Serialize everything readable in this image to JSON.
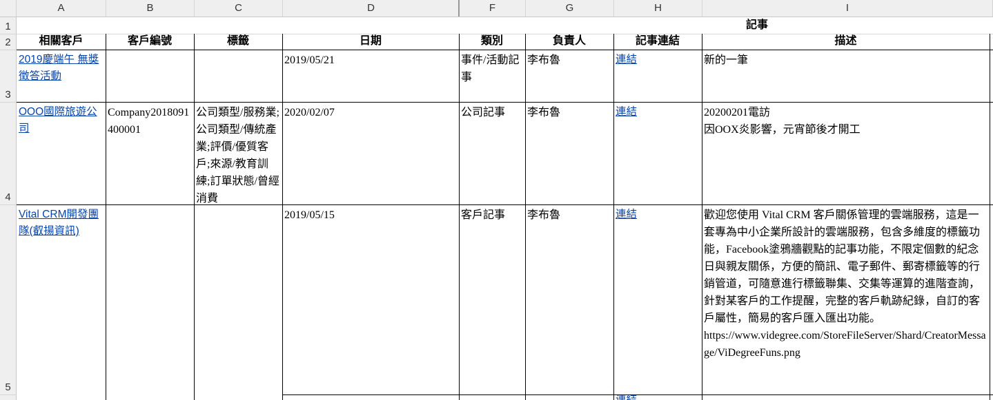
{
  "columns": [
    "A",
    "B",
    "C",
    "D",
    "F",
    "G",
    "H",
    "I"
  ],
  "rows": [
    "1",
    "2",
    "3",
    "4",
    "5"
  ],
  "group_header": "記事",
  "headers": [
    "相關客戶",
    "客戶編號",
    "標籤",
    "日期",
    "類別",
    "負責人",
    "記事連結",
    "描述"
  ],
  "records": [
    {
      "customer": "2019慶端午 無獎徵答活動",
      "customer_id": "",
      "tags": "",
      "date": "2019/05/21",
      "category": "事件/活動記事",
      "owner": "李布魯",
      "link": "連結",
      "description": "新的一筆"
    },
    {
      "customer": "OOO國際旅遊公司",
      "customer_id": "Company2018091400001",
      "tags": "公司類型/服務業;公司類型/傳統產業;評價/優質客戶;來源/教育訓練;訂單狀態/曾經消費",
      "date": "2020/02/07",
      "category": "公司記事",
      "owner": "李布魯",
      "link": "連結",
      "description": "20200201電訪\n因OOX炎影響，元宵節後才開工"
    },
    {
      "customer": "Vital CRM開發團隊(叡揚資訊)",
      "customer_id": "",
      "tags": "",
      "date": "2019/05/15",
      "category": "客戶記事",
      "owner": "李布魯",
      "link": "連結",
      "description": "歡迎您使用 Vital CRM 客戶關係管理的雲端服務，這是一套專為中小企業所設計的雲端服務，包含多維度的標籤功能，Facebook塗鴉牆觀點的記事功能，不限定個數的紀念日與親友關係，方便的簡訊、電子郵件、郵寄標籤等的行銷管道，可隨意進行標籤聯集、交集等運算的進階查詢，針對某客戶的工作提醒，完整的客戶軌跡紀錄，自訂的客戶屬性，簡易的客戶匯入匯出功能。\nhttps://www.videgree.com/StoreFileServer/Shard/CreatorMessage/ViDegreeFuns.png"
    },
    {
      "partial_link": "連結"
    }
  ]
}
